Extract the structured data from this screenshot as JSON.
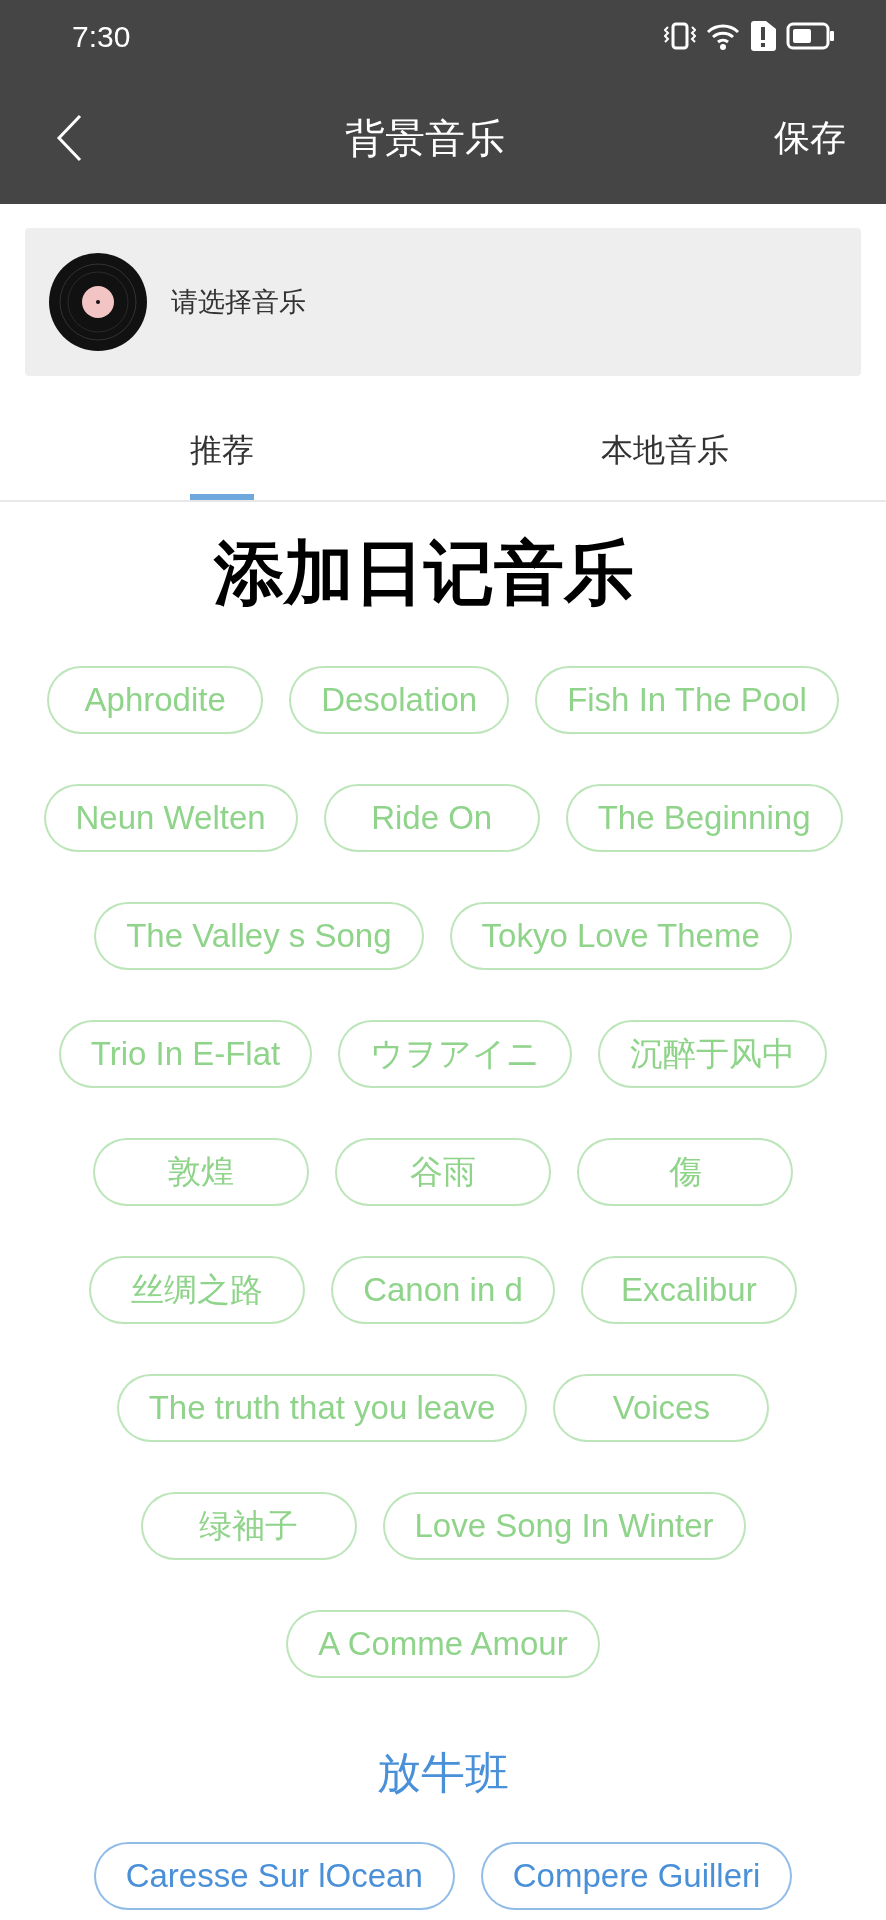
{
  "status_bar": {
    "time": "7:30"
  },
  "header": {
    "title": "背景音乐",
    "action": "保存"
  },
  "current": {
    "text": "请选择音乐"
  },
  "tabs": [
    {
      "label": "推荐",
      "selected": true
    },
    {
      "label": "本地音乐",
      "selected": false
    }
  ],
  "caption": "添加日记音乐",
  "sections": [
    {
      "color": "#8fd48a",
      "songs": [
        "Aphrodite",
        "Desolation",
        "Fish In The Pool",
        "Neun Welten",
        "Ride On",
        "The Beginning",
        "The Valley s Song",
        "Tokyo Love Theme",
        "Trio In E-Flat",
        "ウヲアイニ",
        "沉醉于风中",
        "敦煌",
        "谷雨",
        "傷",
        "丝绸之路",
        "Canon in d",
        "Excalibur",
        "The truth that you leave",
        "Voices",
        "绿袖子",
        "Love Song In Winter",
        "A Comme Amour"
      ]
    },
    {
      "title": "放牛班",
      "color": "#4a90d9",
      "songs": [
        "Caresse Sur lOcean",
        "Compere Guilleri"
      ]
    }
  ]
}
